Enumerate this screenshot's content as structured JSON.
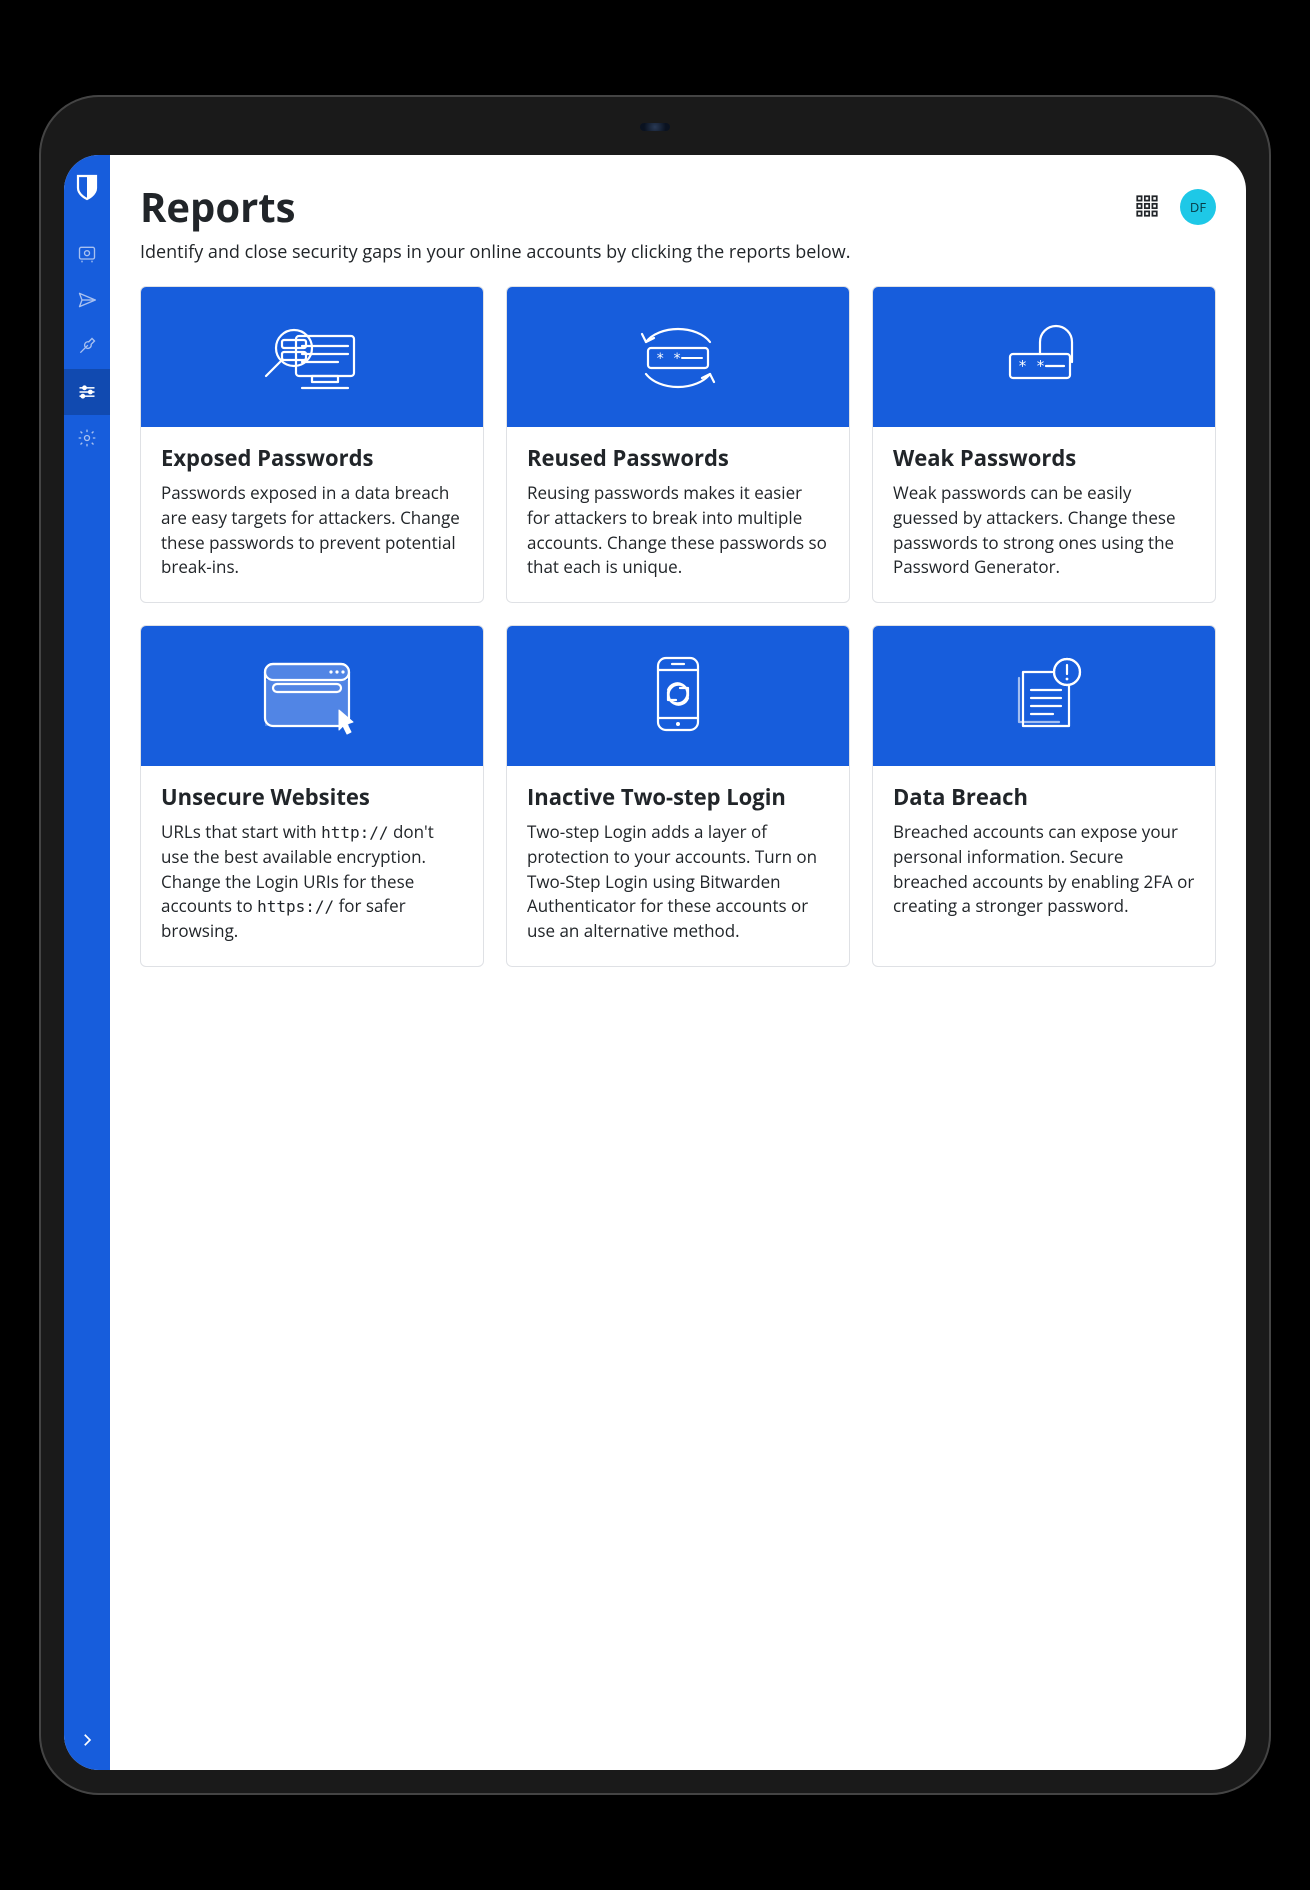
{
  "header": {
    "title": "Reports",
    "subtitle": "Identify and close security gaps in your online accounts by clicking the reports below."
  },
  "avatar": {
    "initials": "DF"
  },
  "sidebar": {
    "items": [
      {
        "name": "vault",
        "icon": "vault-icon",
        "active": false
      },
      {
        "name": "send",
        "icon": "send-icon",
        "active": false
      },
      {
        "name": "tools",
        "icon": "wrench-icon",
        "active": false
      },
      {
        "name": "reports",
        "icon": "sliders-icon",
        "active": true
      },
      {
        "name": "settings",
        "icon": "gear-icon",
        "active": false
      }
    ]
  },
  "reports": [
    {
      "id": "exposed-passwords",
      "icon": "exposed-passwords-icon",
      "title": "Exposed Passwords",
      "desc_html": "Passwords exposed in a data breach are easy targets for attackers. Change these passwords to prevent potential break-ins."
    },
    {
      "id": "reused-passwords",
      "icon": "reused-passwords-icon",
      "title": "Reused Passwords",
      "desc_html": "Reusing passwords makes it easier for attackers to break into multiple accounts. Change these passwords so that each is unique."
    },
    {
      "id": "weak-passwords",
      "icon": "weak-passwords-icon",
      "title": "Weak Passwords",
      "desc_html": "Weak passwords can be easily guessed by attackers. Change these passwords to strong ones using the Password Generator."
    },
    {
      "id": "unsecure-websites",
      "icon": "unsecure-websites-icon",
      "title": "Unsecure Websites",
      "desc_html": "URLs that start with <code>http://</code> don't use the best available encryption. Change the Login URIs for these accounts to <code>https://</code> for safer browsing."
    },
    {
      "id": "inactive-2fa",
      "icon": "inactive-2fa-icon",
      "title": "Inactive Two-step Login",
      "desc_html": "Two-step Login adds a layer of protection to your accounts. Turn on Two-Step Login using Bitwarden Authenticator for these accounts or use an alternative method."
    },
    {
      "id": "data-breach",
      "icon": "data-breach-icon",
      "title": "Data Breach",
      "desc_html": "Breached accounts can expose your personal information. Secure breached accounts by enabling 2FA or creating a stronger password."
    }
  ],
  "colors": {
    "brand": "#175DDC",
    "avatar_bg": "#1ec8e7"
  }
}
